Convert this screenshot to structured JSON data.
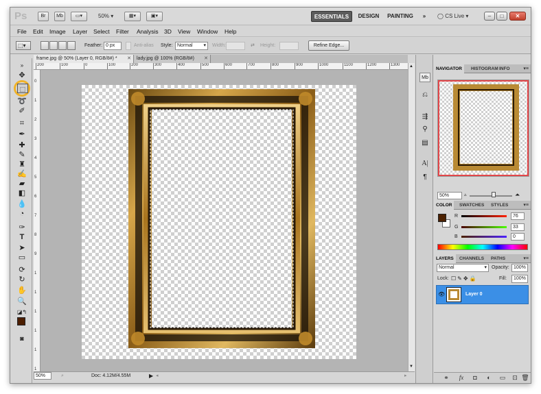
{
  "app": {
    "logo_text": "Ps",
    "bridge_label": "Br",
    "minibridge_label": "Mb",
    "zoom_display": "50%",
    "workspaces": [
      "ESSENTIALS",
      "DESIGN",
      "PAINTING"
    ],
    "overflow_label": "»",
    "cslive_label": "CS Live"
  },
  "menu": [
    "File",
    "Edit",
    "Image",
    "Layer",
    "Select",
    "Filter",
    "Analysis",
    "3D",
    "View",
    "Window",
    "Help"
  ],
  "options": {
    "feather_label": "Feather:",
    "feather_value": "0 px",
    "antialias_label": "Anti-alias",
    "style_label": "Style:",
    "style_value": "Normal",
    "width_label": "Width:",
    "height_label": "Height:",
    "refine_label": "Refine Edge..."
  },
  "tabs": [
    {
      "label": "frame.jpg @ 50% (Layer 0, RGB/8#) *"
    },
    {
      "label": "lady.jpg @ 100% (RGB/8#)"
    }
  ],
  "ruler": {
    "top": [
      "200",
      "100",
      "0",
      "100",
      "200",
      "300",
      "400",
      "500",
      "600",
      "700",
      "800",
      "900",
      "1000",
      "1100",
      "1200",
      "1300"
    ],
    "left": [
      "0",
      "1",
      "2",
      "3",
      "4",
      "5",
      "6",
      "7",
      "8",
      "9",
      "1",
      "1",
      "1",
      "1",
      "1",
      "1"
    ]
  },
  "status": {
    "zoom": "50%",
    "doc": "Doc: 4.12M/4.55M"
  },
  "panels": {
    "nav_tabs": [
      "NAVIGATOR",
      "HISTOGRAM",
      "INFO"
    ],
    "nav_zoom": "50%",
    "color_tabs": [
      "COLOR",
      "SWATCHES",
      "STYLES"
    ],
    "color": {
      "r_label": "R",
      "r_value": "76",
      "g_label": "G",
      "g_value": "33",
      "b_label": "B",
      "b_value": "0",
      "fg_hex": "#4c2100"
    },
    "layer_tabs": [
      "LAYERS",
      "CHANNELS",
      "PATHS"
    ],
    "blend_mode": "Normal",
    "opacity_label": "Opacity:",
    "opacity_value": "100%",
    "lock_label": "Lock:",
    "fill_label": "Fill:",
    "fill_value": "100%",
    "layer_name": "Layer 0"
  },
  "colors": {
    "accent": "#3b8fe6",
    "nav_box": "#e4474a",
    "highlight": "#f0b228"
  }
}
